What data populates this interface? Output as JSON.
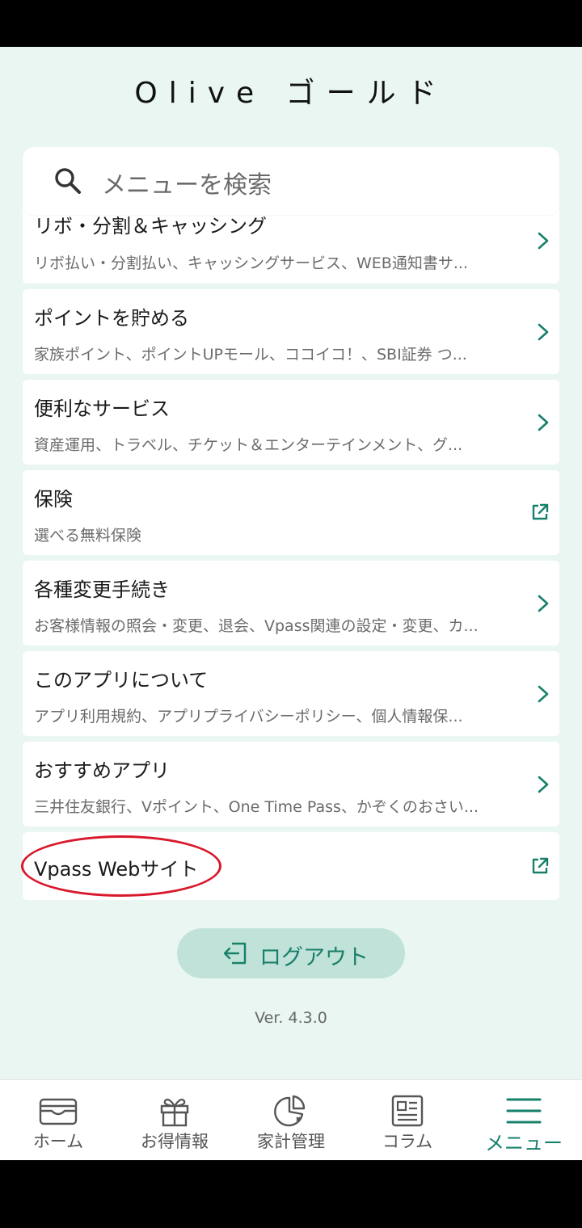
{
  "header": {
    "title": "Olive ゴールド"
  },
  "search": {
    "placeholder": "メニューを検索"
  },
  "menu": {
    "items": [
      {
        "title": "リボ・分割＆キャッシング",
        "subtitle": "リボ払い・分割払い、キャッシングサービス、WEB通知書サ...",
        "icon": "chevron-right-icon"
      },
      {
        "title": "ポイントを貯める",
        "subtitle": "家族ポイント、ポイントUPモール、ココイコ！、SBI証券 つ...",
        "icon": "chevron-right-icon"
      },
      {
        "title": "便利なサービス",
        "subtitle": "資産運用、トラベル、チケット＆エンターテインメント、グ...",
        "icon": "chevron-right-icon"
      },
      {
        "title": "保険",
        "subtitle": "選べる無料保険",
        "icon": "external-link-icon"
      },
      {
        "title": "各種変更手続き",
        "subtitle": "お客様情報の照会・変更、退会、Vpass関連の設定・変更、カ...",
        "icon": "chevron-right-icon"
      },
      {
        "title": "このアプリについて",
        "subtitle": "アプリ利用規約、アプリプライバシーポリシー、個人情報保...",
        "icon": "chevron-right-icon"
      },
      {
        "title": "おすすめアプリ",
        "subtitle": "三井住友銀行、Vポイント、One Time Pass、かぞくのおさい...",
        "icon": "chevron-right-icon"
      },
      {
        "title": "Vpass Webサイト",
        "icon": "external-link-icon"
      }
    ]
  },
  "logout": {
    "label": "ログアウト"
  },
  "version": "Ver. 4.3.0",
  "nav": {
    "items": [
      {
        "label": "ホーム",
        "icon": "wallet-icon"
      },
      {
        "label": "お得情報",
        "icon": "gift-icon"
      },
      {
        "label": "家計管理",
        "icon": "pie-chart-icon"
      },
      {
        "label": "コラム",
        "icon": "newspaper-icon"
      },
      {
        "label": "メニュー",
        "icon": "hamburger-menu-icon",
        "active": true
      }
    ]
  },
  "colors": {
    "accent": "#16806b",
    "background": "#eaf6f1",
    "highlight": "#d9182c",
    "logout_button": "#c0e2d8"
  }
}
